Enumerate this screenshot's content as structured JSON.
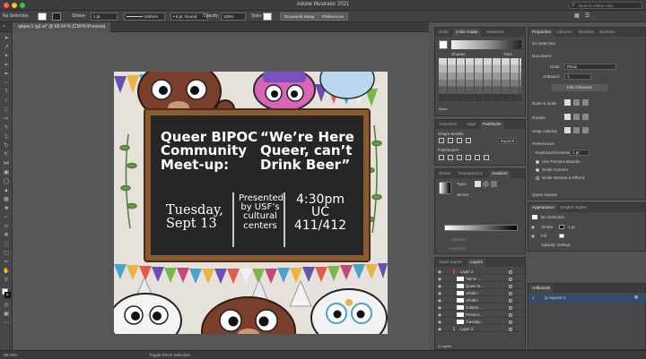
{
  "app": {
    "title": "Adobe Illustrator 2021"
  },
  "control_bar": {
    "selection": "No Selection",
    "stroke_label": "Stroke:",
    "stroke_value": "1 pt",
    "uniform": "Uniform",
    "brush": "5 pt. Round",
    "opacity_label": "Opacity:",
    "opacity_value": "100%",
    "style_label": "Style:",
    "doc_setup": "Document Setup",
    "preferences": "Preferences"
  },
  "header_right": {
    "search": "Search Adobe Help"
  },
  "document_tab": "qbipoc1 ig2.ai* @ 68.04 % (CMYK/Preview)",
  "artwork": {
    "heading_left": [
      "Queer BIPOC",
      "Community",
      "Meet-up:"
    ],
    "heading_right": [
      "“We’re Here",
      "Queer, can’t",
      "Drink Beer”"
    ],
    "date": [
      "Tuesday,",
      "Sept 13"
    ],
    "presented": [
      "Presented",
      "by USF’s",
      "cultural",
      "centers"
    ],
    "time": [
      "4:30pm",
      "UC",
      "411/412"
    ]
  },
  "color_panel": {
    "tabs": [
      "Color",
      "Color Guide",
      "Swatches"
    ],
    "shades": "Shades",
    "tints": "Tints",
    "none_label": "None",
    "colors": {
      "brand_blue": "#2680eb"
    }
  },
  "pathfinder_panel": {
    "tabs": [
      "Transform",
      "Align",
      "Pathfinder"
    ],
    "shape_modes": "Shape Modes:",
    "expand": "Expand",
    "pathfinders": "Pathfinders:"
  },
  "gradient_panel": {
    "tabs": [
      "Stroke",
      "Transparency",
      "Gradient"
    ],
    "type": "Type:",
    "stroke": "Stroke:",
    "opacity": "Opacity:",
    "location": "Location:"
  },
  "layers_panel": {
    "tabs": [
      "Asset Export",
      "Layers"
    ],
    "rows": [
      {
        "name": "Layer 2",
        "type": "layer"
      },
      {
        "name": "“We're ...",
        "type": "item"
      },
      {
        "name": "Queer B...",
        "type": "item"
      },
      {
        "name": "<Path>",
        "type": "item"
      },
      {
        "name": "<Path>",
        "type": "item"
      },
      {
        "name": "4:30pm...",
        "type": "item"
      },
      {
        "name": "Present...",
        "type": "item"
      },
      {
        "name": "Tuesday...",
        "type": "item"
      },
      {
        "name": "Layer 3",
        "type": "layer"
      }
    ],
    "footer": "2 Layers"
  },
  "properties_panel": {
    "tabs": [
      "Properties",
      "Libraries",
      "Brushes",
      "Symbols"
    ],
    "no_selection": "No Selection",
    "document": "Document",
    "units_label": "Units:",
    "units_value": "Picas",
    "artboard_label": "Artboard:",
    "artboard_value": "1",
    "edit_artboards": "Edit Artboards",
    "ruler_grids": "Ruler & Grids",
    "guides": "Guides",
    "snap_options": "Snap Options",
    "preferences": "Preferences",
    "keyboard_increment": "Keyboard Increment:",
    "keyboard_value": "1 pt",
    "use_preview_bounds": "Use Preview Bounds",
    "scale_corners": "Scale Corners",
    "scale_strokes": "Scale Strokes & Effects",
    "quick_actions": "Quick Actions"
  },
  "appearance_panel": {
    "tabs": [
      "Appearance",
      "Graphic Styles"
    ],
    "no_selection": "No Selection",
    "stroke_label": "Stroke",
    "stroke_value": "1 pt",
    "fill_label": "Fill",
    "opacity": "Opacity: Default"
  },
  "artboards_panel": {
    "tab": "Artboards",
    "index": "1",
    "name": "ig Square 2"
  },
  "status": {
    "zoom": "68.04%",
    "tool": "Toggle Direct Selection"
  }
}
